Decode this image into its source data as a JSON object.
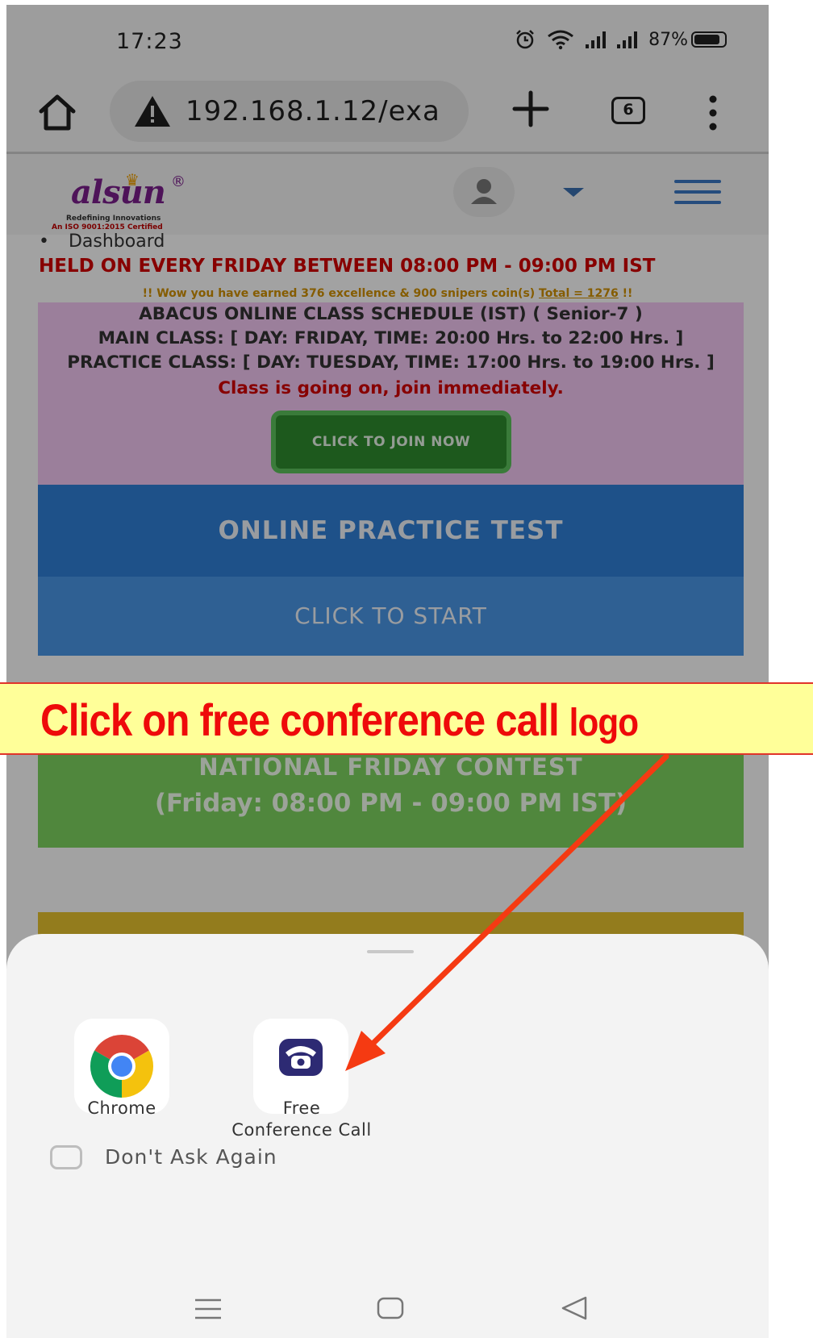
{
  "status_bar": {
    "time": "17:23",
    "battery": "87%",
    "battery_level_percent": 87
  },
  "browser": {
    "url": "192.168.1.12/exa",
    "tab_count": "6"
  },
  "site": {
    "logo_text": "alsun",
    "logo_tagline": "Redefining Innovations",
    "logo_certification": "An ISO 9001:2015 Certified",
    "breadcrumb": "Dashboard",
    "marquee": "HELD ON EVERY FRIDAY BETWEEN 08:00 PM - 09:00 PM IST",
    "coins_prefix": "!! Wow you have earned 376 excellence & 900 snipers coin(s) ",
    "coins_total": "Total = 1276",
    "coins_suffix": " !!",
    "schedule": {
      "title": "ABACUS ONLINE CLASS SCHEDULE (IST) ( Senior-7 )",
      "main_class": "MAIN CLASS: [ DAY: FRIDAY, TIME: 20:00 Hrs. to 22:00 Hrs. ]",
      "practice_class": "PRACTICE CLASS: [ DAY: TUESDAY, TIME: 17:00 Hrs. to 19:00 Hrs. ]",
      "alert": "Class is going on, join immediately.",
      "join_button": "CLICK TO JOIN NOW"
    },
    "practice_test": {
      "title": "ONLINE PRACTICE TEST",
      "start": "CLICK TO START"
    },
    "contest": {
      "title": "NATIONAL FRIDAY CONTEST",
      "time": "(Friday: 08:00 PM - 09:00 PM IST)"
    }
  },
  "sheet": {
    "apps": [
      {
        "label": "Chrome",
        "icon": "chrome-icon"
      },
      {
        "label_line1": "Free",
        "label_line2": "Conference Call",
        "icon": "free-conference-call-icon"
      }
    ],
    "dont_ask_again": "Don't Ask Again"
  },
  "annotation": {
    "text_main": "Click on free conference call",
    "text_tail": "logo"
  },
  "colors": {
    "annotation_red": "#ee0a0a",
    "annotation_bg": "#ffff99",
    "practice_blue": "#2f7fd6",
    "join_green": "#2e8b2e",
    "schedule_pink": "#f2c7f2",
    "contest_green": "#7ed360"
  }
}
